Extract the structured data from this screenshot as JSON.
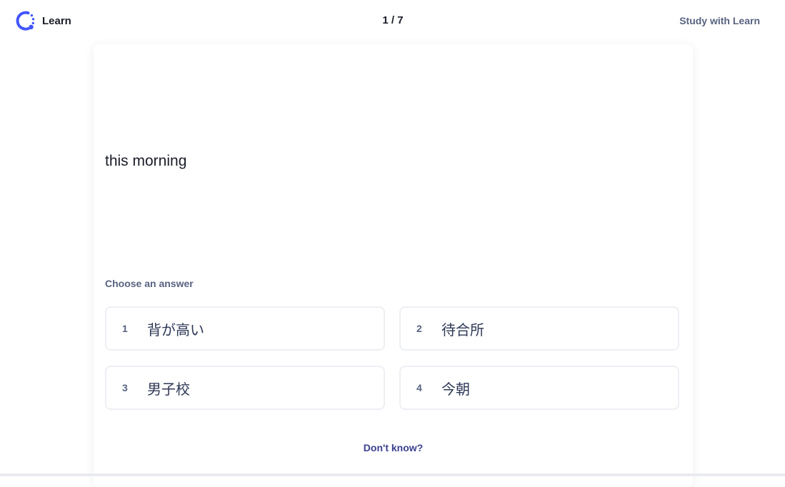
{
  "header": {
    "brand_label": "Learn",
    "progress": "1 / 7",
    "study_link": "Study with Learn"
  },
  "question": {
    "term": "this morning",
    "prompt": "Choose an answer"
  },
  "options": [
    {
      "number": "1",
      "text": "背が高い"
    },
    {
      "number": "2",
      "text": "待合所"
    },
    {
      "number": "3",
      "text": "男子校"
    },
    {
      "number": "4",
      "text": "今朝"
    }
  ],
  "footer": {
    "dont_know": "Don't know?"
  },
  "colors": {
    "accent": "#4255ff",
    "text_primary": "#1a1d28",
    "text_secondary": "#586380",
    "border": "#edeff4"
  },
  "icons": {
    "brand": "learn-progress-icon"
  }
}
